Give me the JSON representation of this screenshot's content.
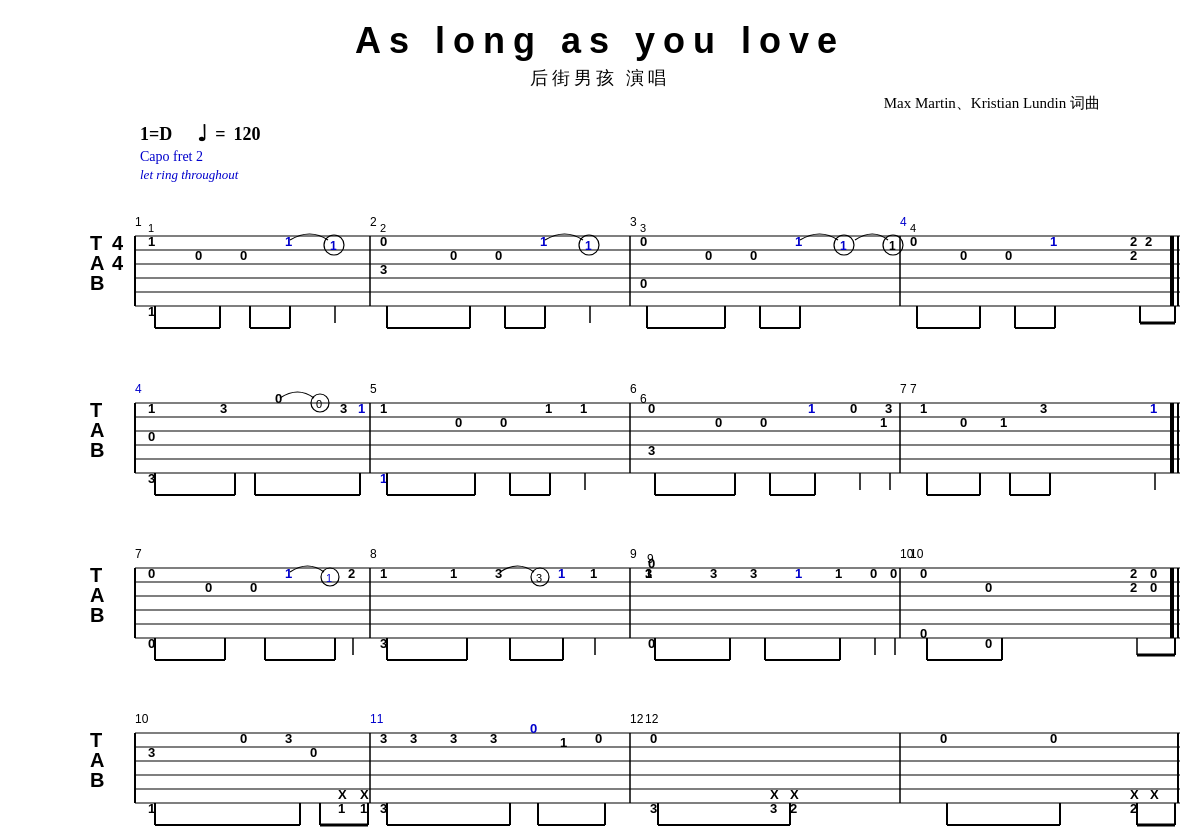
{
  "title": "As long as you love",
  "subtitle": "后街男孩 演唱",
  "composer": "Max Martin、Kristian Lundin 词曲",
  "tempo": {
    "key": "1=D",
    "bpm": "120",
    "note_symbol": "♩"
  },
  "capo": "Capo fret 2",
  "let_ring": "let ring throughout",
  "tab_time_signature": "4/4"
}
